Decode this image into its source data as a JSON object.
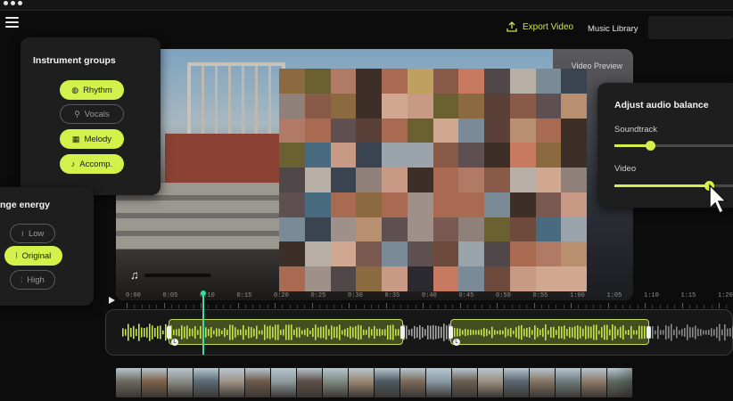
{
  "header": {
    "export_label": "Export Video",
    "export_icon": "upload-icon",
    "music_library_label": "Music Library"
  },
  "video": {
    "preview_label": "Video Preview"
  },
  "instrument_groups": {
    "title": "Instrument groups",
    "items": [
      {
        "label": "Rhythm",
        "active": true,
        "icon": "drum-icon"
      },
      {
        "label": "Vocals",
        "active": false,
        "icon": "microphone-icon"
      },
      {
        "label": "Melody",
        "active": true,
        "icon": "keyboard-icon"
      },
      {
        "label": "Accomp.",
        "active": true,
        "icon": "guitar-icon"
      }
    ]
  },
  "energy": {
    "title": "nge energy",
    "items": [
      {
        "label": "Low",
        "active": false,
        "icon": "wave-low-icon"
      },
      {
        "label": "Original",
        "active": true,
        "icon": "wave-mid-icon"
      },
      {
        "label": "High",
        "active": false,
        "icon": "wave-high-icon"
      }
    ]
  },
  "audio_balance": {
    "title": "Adjust audio balance",
    "soundtrack_label": "Soundtrack",
    "soundtrack_level": 0.3,
    "video_label": "Video",
    "video_level": 0.8
  },
  "timeline": {
    "ticks": [
      "0:00",
      "0:05",
      "0:10",
      "0:15",
      "0:20",
      "0:25",
      "0:30",
      "0:35",
      "0:40",
      "0:45",
      "0:50",
      "0:55",
      "1:00",
      "1:05",
      "1:10",
      "1:15",
      "1:20"
    ],
    "playhead_time": "0:06",
    "segments": [
      {
        "start": "0:03",
        "end": "0:33",
        "badge": "L"
      },
      {
        "start": "0:47",
        "end": "1:06",
        "badge": "L"
      }
    ]
  },
  "colors": {
    "accent": "#d4f04b",
    "playhead": "#34e0a6",
    "panel": "#1e1e1e",
    "background": "#0c0c0c"
  }
}
